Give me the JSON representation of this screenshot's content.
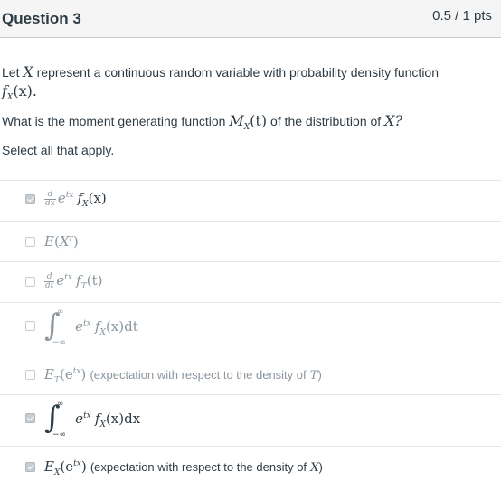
{
  "header": {
    "title": "Question 3",
    "points": "0.5 / 1 pts"
  },
  "stem": {
    "line1_prefix": "Let",
    "var_X": "X",
    "line1_suffix": "represent a continuous random variable with probability density function",
    "pdf_f": "f",
    "pdf_sub": "X",
    "pdf_arg": "(x).",
    "line2_prefix": "What is the moment generating function",
    "mgf_M": "M",
    "mgf_sub": "X",
    "mgf_arg": "(t)",
    "line2_mid": "of the distribution of",
    "line2_var": "X?",
    "line3": "Select all that apply."
  },
  "answers": [
    {
      "checked": true,
      "d_num": "d",
      "d_den": "dx",
      "e": "e",
      "sup": "tx",
      "f": "f",
      "sub": "X",
      "arg": "(x)"
    },
    {
      "checked": false,
      "E": "E",
      "paren_open": "(",
      "X": "X",
      "sup": "r",
      "paren_close": ")"
    },
    {
      "checked": false,
      "d_num": "d",
      "d_den": "dt",
      "e": "e",
      "sup": "tx",
      "f": "f",
      "sub": "T",
      "arg": "(t)"
    },
    {
      "checked": false,
      "upper": "∞",
      "lower": "−∞",
      "e": "e",
      "sup": "tx",
      "f": "f",
      "sub": "X",
      "arg": "(x)dt"
    },
    {
      "checked": false,
      "E": "E",
      "E_sub": "T",
      "inner": "(e",
      "sup": "tx",
      "close": ")",
      "note": "(expectation with respect to the density of",
      "note_var": "T",
      "note_close": ")"
    },
    {
      "checked": true,
      "upper": "∞",
      "lower": "−∞",
      "e": "e",
      "sup": "tx",
      "f": "f",
      "sub": "X",
      "arg": "(x)dx"
    },
    {
      "checked": true,
      "E": "E",
      "E_sub": "X",
      "inner": "(e",
      "sup": "tx",
      "close": ")",
      "note": "(expectation with respect to the density of",
      "note_var": "X",
      "note_close": ")"
    }
  ]
}
